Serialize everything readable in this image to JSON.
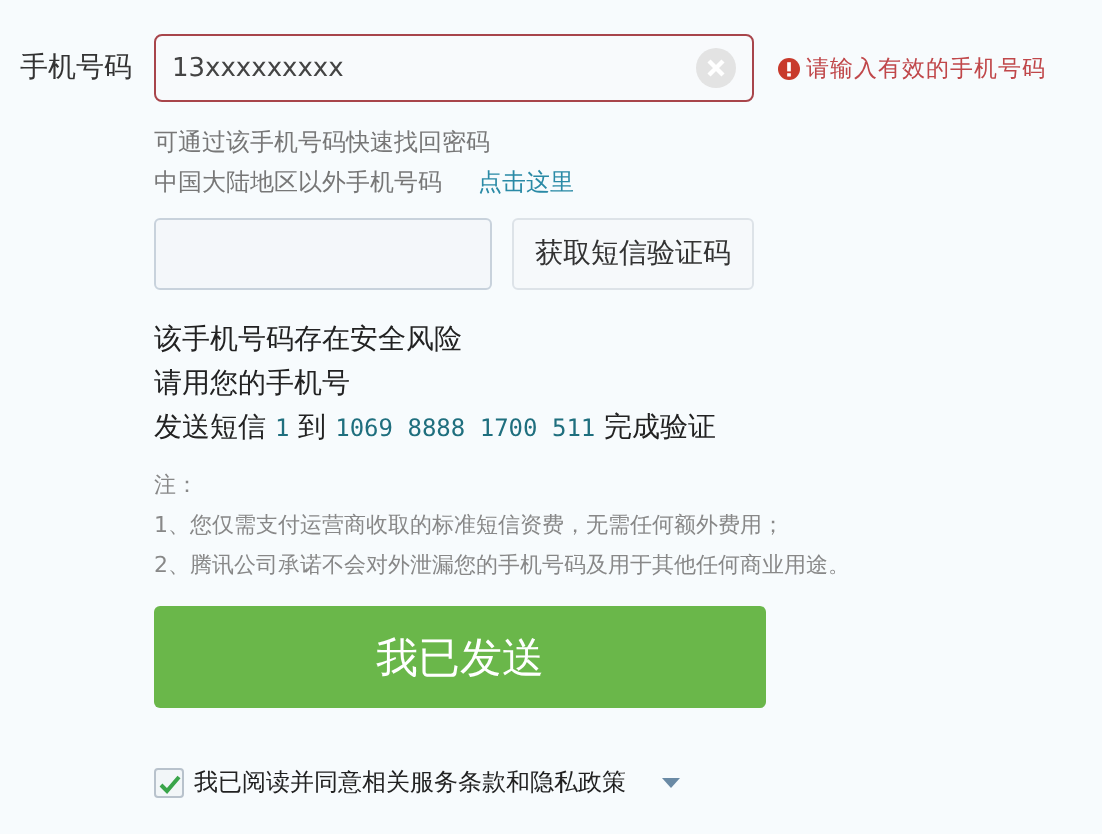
{
  "phone": {
    "label": "手机号码",
    "value": "13xxxxxxxxx",
    "error": "请输入有效的手机号码"
  },
  "hints": {
    "line_1": "可通过该手机号码快速找回密码",
    "line_2": "中国大陆地区以外手机号码",
    "link": "点击这里"
  },
  "sms_code": {
    "button": "获取短信验证码"
  },
  "warning": {
    "lines": [
      "该手机号码存在安全风险",
      "请用您的手机号"
    ],
    "sms_line": [
      {
        "kind": "text",
        "text": "发送短信"
      },
      {
        "kind": "code",
        "text": "1"
      },
      {
        "kind": "text",
        "text": "到"
      },
      {
        "kind": "code",
        "text": "1069 8888 1700 511"
      },
      {
        "kind": "text",
        "text": "完成验证"
      }
    ]
  },
  "notes": [
    "注：",
    "1、您仅需支付运营商收取的标准短信资费，无需任何额外费用；",
    "2、腾讯公司承诺不会对外泄漏您的手机号码及用于其他任何商业用途。"
  ],
  "submit": "我已发送",
  "agreement": {
    "checked": true,
    "text": "我已阅读并同意相关服务条款和隐私政策"
  }
}
